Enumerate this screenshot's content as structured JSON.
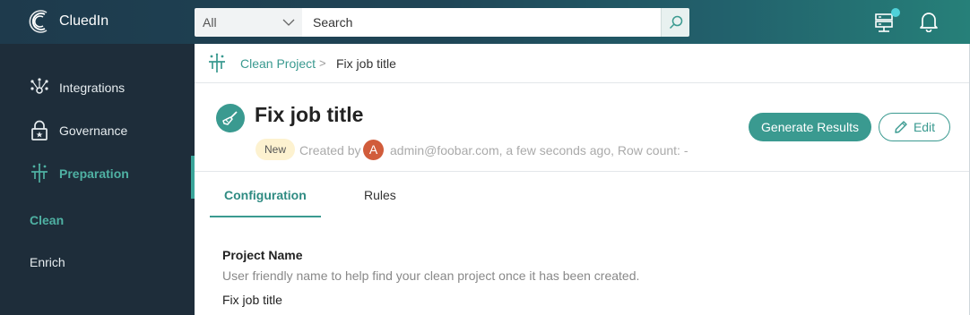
{
  "app": {
    "name": "CluedIn"
  },
  "search": {
    "scope": "All",
    "placeholder": "Search"
  },
  "sidebar": {
    "items": [
      {
        "label": "Integrations",
        "icon": "integrations-icon"
      },
      {
        "label": "Governance",
        "icon": "lock-icon"
      },
      {
        "label": "Preparation",
        "icon": "preparation-icon"
      }
    ],
    "subitems": [
      {
        "label": "Clean"
      },
      {
        "label": "Enrich"
      }
    ]
  },
  "breadcrumb": {
    "parent": "Clean Project",
    "separator": ">",
    "current": "Fix job title"
  },
  "project": {
    "title": "Fix job title",
    "status": "New",
    "created_by_label": "Created by",
    "avatar_initial": "A",
    "meta": "admin@foobar.com, a few seconds ago, Row count: -"
  },
  "actions": {
    "generate": "Generate Results",
    "edit": "Edit"
  },
  "tabs": [
    {
      "label": "Configuration"
    },
    {
      "label": "Rules"
    }
  ],
  "form": {
    "label": "Project Name",
    "help": "User friendly name to help find your clean project once it has been created.",
    "value": "Fix job title"
  },
  "colors": {
    "accent": "#3a9a90",
    "sidebar": "#1e2d3a",
    "topbar": "#1e3a4c",
    "avatar": "#d15c3b",
    "badge": "#fdf2d0"
  }
}
